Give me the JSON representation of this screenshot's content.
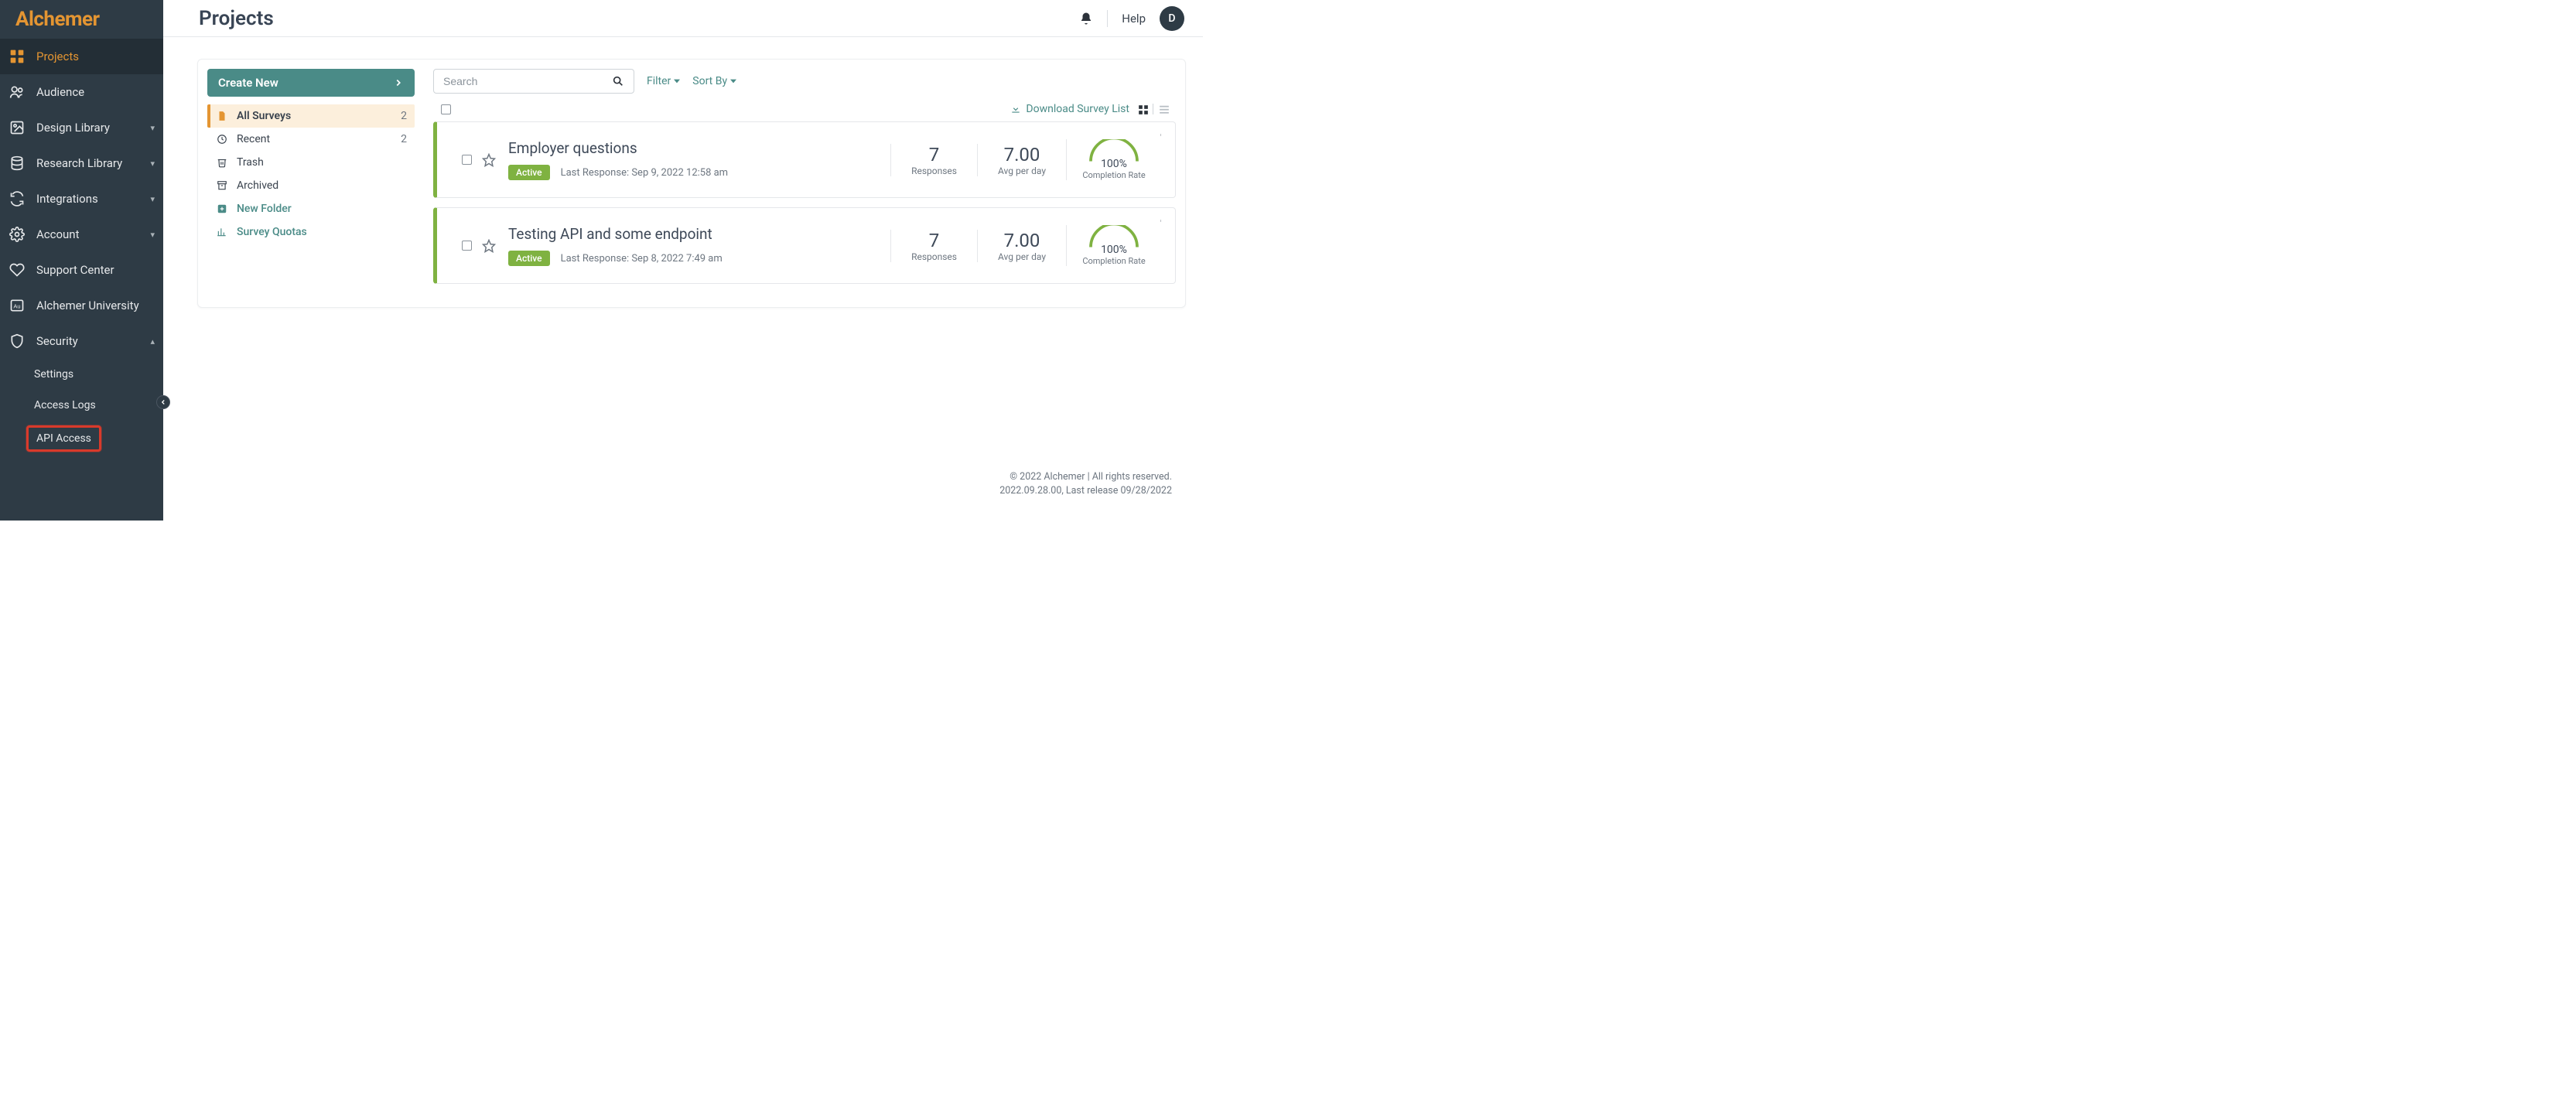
{
  "brand": "Alchemer",
  "page_title": "Projects",
  "topbar": {
    "help": "Help",
    "avatar_initial": "D"
  },
  "sidebar": {
    "items": [
      {
        "label": "Projects",
        "icon": "grid-icon",
        "active": true,
        "expandable": false,
        "expanded": false
      },
      {
        "label": "Audience",
        "icon": "users-icon",
        "active": false,
        "expandable": false,
        "expanded": false
      },
      {
        "label": "Design Library",
        "icon": "image-icon",
        "active": false,
        "expandable": true,
        "expanded": false
      },
      {
        "label": "Research Library",
        "icon": "database-icon",
        "active": false,
        "expandable": true,
        "expanded": false
      },
      {
        "label": "Integrations",
        "icon": "sync-icon",
        "active": false,
        "expandable": true,
        "expanded": false
      },
      {
        "label": "Account",
        "icon": "gear-icon",
        "active": false,
        "expandable": true,
        "expanded": false
      },
      {
        "label": "Support Center",
        "icon": "heart-icon",
        "active": false,
        "expandable": false,
        "expanded": false
      },
      {
        "label": "Alchemer University",
        "icon": "au-icon",
        "active": false,
        "expandable": false,
        "expanded": false
      },
      {
        "label": "Security",
        "icon": "shield-icon",
        "active": false,
        "expandable": true,
        "expanded": true
      }
    ],
    "security_sub": [
      {
        "label": "Settings",
        "highlight": false
      },
      {
        "label": "Access Logs",
        "highlight": false
      },
      {
        "label": "API Access",
        "highlight": true
      }
    ]
  },
  "folders": {
    "create_label": "Create New",
    "items": [
      {
        "label": "All Surveys",
        "icon": "file-icon",
        "count": "2",
        "active": true,
        "teal": false
      },
      {
        "label": "Recent",
        "icon": "clock-icon",
        "count": "2",
        "active": false,
        "teal": false
      },
      {
        "label": "Trash",
        "icon": "trash-icon",
        "count": "",
        "active": false,
        "teal": false
      },
      {
        "label": "Archived",
        "icon": "archive-icon",
        "count": "",
        "active": false,
        "teal": false
      },
      {
        "label": "New Folder",
        "icon": "plus-square-icon",
        "count": "",
        "active": false,
        "teal": true
      },
      {
        "label": "Survey Quotas",
        "icon": "bar-chart-icon",
        "count": "",
        "active": false,
        "teal": true
      }
    ]
  },
  "toolbar": {
    "search_placeholder": "Search",
    "filter": "Filter",
    "sort": "Sort By",
    "download": "Download Survey List"
  },
  "surveys": [
    {
      "title": "Employer questions",
      "status": "Active",
      "meta": "Last Response: Sep 9, 2022 12:58 am",
      "responses": "7",
      "resp_lbl": "Responses",
      "avg": "7.00",
      "avg_lbl": "Avg per day",
      "pct": "100%",
      "pct_lbl": "Completion Rate"
    },
    {
      "title": "Testing API and some endpoint",
      "status": "Active",
      "meta": "Last Response: Sep 8, 2022 7:49 am",
      "responses": "7",
      "resp_lbl": "Responses",
      "avg": "7.00",
      "avg_lbl": "Avg per day",
      "pct": "100%",
      "pct_lbl": "Completion Rate"
    }
  ],
  "footer": {
    "line1": "© 2022 Alchemer | All rights reserved.",
    "line2": "2022.09.28.00, Last release 09/28/2022"
  },
  "colors": {
    "accent": "#e49532",
    "teal": "#4a8b87",
    "green": "#7fb241",
    "dark": "#2e3b45"
  }
}
